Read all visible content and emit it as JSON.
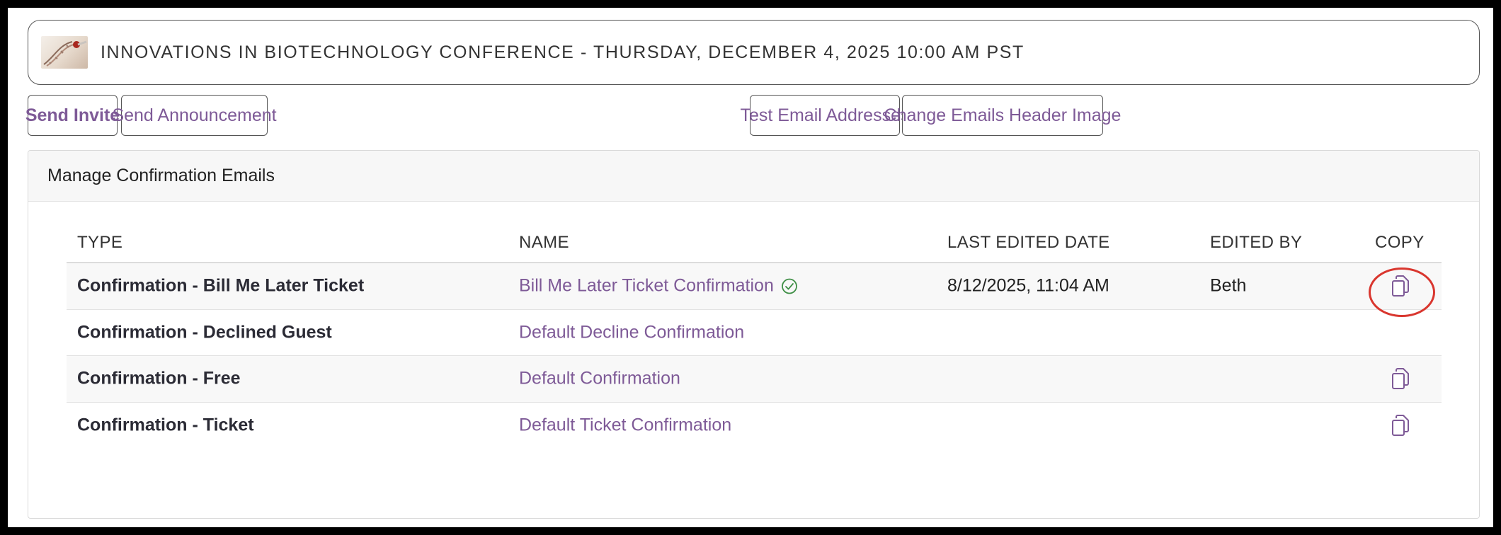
{
  "event": {
    "title": "INNOVATIONS IN BIOTECHNOLOGY CONFERENCE - THURSDAY, DECEMBER 4, 2025 10:00 AM PST",
    "thumbnail_icon": "dna-thumbnail"
  },
  "toolbar": {
    "send_invite": "Send Invite",
    "send_announcement": "Send Announcement",
    "test_email_addresses": "Test Email Addresses",
    "change_header_image": "Change Emails Header Image"
  },
  "panel": {
    "title": "Manage Confirmation Emails"
  },
  "table": {
    "columns": [
      "TYPE",
      "NAME",
      "LAST EDITED DATE",
      "EDITED BY",
      "COPY"
    ],
    "rows": [
      {
        "type": "Confirmation - Bill Me Later Ticket",
        "name": "Bill Me Later Ticket Confirmation",
        "verified": true,
        "last_edited": "8/12/2025, 11:04 AM",
        "edited_by": "Beth",
        "copy": true
      },
      {
        "type": "Confirmation - Declined Guest",
        "name": "Default Decline Confirmation",
        "verified": false,
        "last_edited": "",
        "edited_by": "",
        "copy": false
      },
      {
        "type": "Confirmation - Free",
        "name": "Default Confirmation",
        "verified": false,
        "last_edited": "",
        "edited_by": "",
        "copy": true
      },
      {
        "type": "Confirmation - Ticket",
        "name": "Default Ticket Confirmation",
        "verified": false,
        "last_edited": "",
        "edited_by": "",
        "copy": true
      }
    ]
  },
  "colors": {
    "accent": "#7e5a97",
    "verified": "#3f8f46",
    "highlight": "#d9362e"
  }
}
